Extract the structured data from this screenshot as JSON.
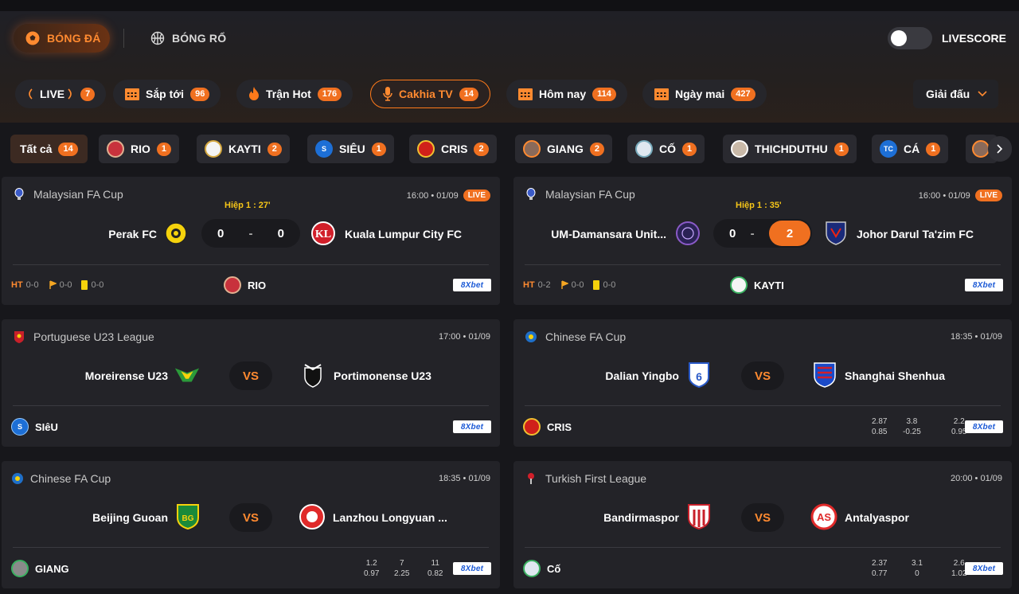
{
  "sports": {
    "football": "BÓNG ĐÁ",
    "basketball": "BÓNG RỔ"
  },
  "livescore_label": "LIVESCORE",
  "filters": [
    {
      "label": "LIVE",
      "count": "7"
    },
    {
      "label": "Sắp tới",
      "count": "96"
    },
    {
      "label": "Trận Hot",
      "count": "176"
    },
    {
      "label": "Cakhia TV",
      "count": "14"
    },
    {
      "label": "Hôm nay",
      "count": "114"
    },
    {
      "label": "Ngày mai",
      "count": "427"
    }
  ],
  "league_dropdown": "Giải đấu",
  "streamers": [
    {
      "label": "Tất cả",
      "count": "14"
    },
    {
      "label": "RIO",
      "count": "1"
    },
    {
      "label": "KAYTI",
      "count": "2"
    },
    {
      "label": "SIÊU",
      "count": "1"
    },
    {
      "label": "CRIS",
      "count": "2"
    },
    {
      "label": "GIANG",
      "count": "2"
    },
    {
      "label": "CỐ",
      "count": "1"
    },
    {
      "label": "THICHDUTHU",
      "count": "1"
    },
    {
      "label": "CÁ",
      "count": "1"
    }
  ],
  "bet_label": "8Xbet",
  "matches": [
    {
      "league": "Malaysian FA Cup",
      "time": "16:00 • 01/09",
      "live": "LIVE",
      "half": "Hiệp 1 :  27'",
      "home": "Perak FC",
      "away": "Kuala Lumpur City FC",
      "home_score": "0",
      "sep": "-",
      "away_score": "0",
      "ht": "HT",
      "ht_score": "0-0",
      "corners": "0-0",
      "cards": "0-0",
      "streamer": "RIO"
    },
    {
      "league": "Malaysian FA Cup",
      "time": "16:00 • 01/09",
      "live": "LIVE",
      "half": "Hiệp 1 :  35'",
      "home": "UM-Damansara Unit...",
      "away": "Johor Darul Ta'zim FC",
      "home_score": "0",
      "sep": "-",
      "away_score": "2",
      "ht": "HT",
      "ht_score": "0-2",
      "corners": "0-0",
      "cards": "0-0",
      "streamer": "KAYTI"
    },
    {
      "league": "Portuguese U23 League",
      "time": "17:00 • 01/09",
      "home": "Moreirense U23",
      "away": "Portimonense U23",
      "vs": "VS",
      "streamer": "SIêU"
    },
    {
      "league": "Chinese FA Cup",
      "time": "18:35 • 01/09",
      "home": "Dalian Yingbo",
      "away": "Shanghai Shenhua",
      "vs": "VS",
      "streamer": "CRIS",
      "odds": [
        [
          "2.87",
          "0.85"
        ],
        [
          "3.8",
          "-0.25"
        ],
        [
          "2.2",
          "0.95"
        ]
      ]
    },
    {
      "league": "Chinese FA Cup",
      "time": "18:35 • 01/09",
      "home": "Beijing Guoan",
      "away": "Lanzhou Longyuan ...",
      "vs": "VS",
      "streamer": "GIANG",
      "odds": [
        [
          "1.2",
          "0.97"
        ],
        [
          "7",
          "2.25"
        ],
        [
          "11",
          "0.82"
        ]
      ]
    },
    {
      "league": "Turkish First League",
      "time": "20:00 • 01/09",
      "home": "Bandirmaspor",
      "away": "Antalyaspor",
      "vs": "VS",
      "streamer": "Cố",
      "odds": [
        [
          "2.37",
          "0.77"
        ],
        [
          "3.1",
          "0"
        ],
        [
          "2.6",
          "1.02"
        ]
      ]
    }
  ]
}
